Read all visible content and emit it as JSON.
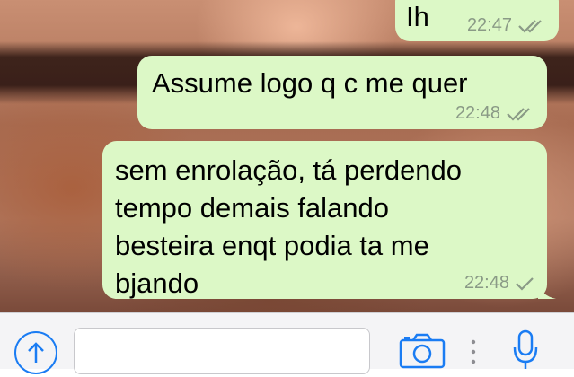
{
  "messages": [
    {
      "text": "Ih",
      "time": "22:47",
      "status": "read"
    },
    {
      "text": "Assume logo q c me quer",
      "time": "22:48",
      "status": "read"
    },
    {
      "text": "sem enrolação, tá perdendo\ntempo demais falando\nbesteira enqt podia ta me\nbjando",
      "time": "22:48",
      "status": "sent"
    }
  ],
  "input_bar": {
    "message_value": "",
    "icons": [
      "upload-arrow-icon",
      "camera-icon",
      "more-dots-icon",
      "microphone-icon"
    ],
    "accent_color": "#1a7cf3"
  },
  "colors": {
    "bubble": "#dcf8c6",
    "meta": "#8a9a86"
  }
}
